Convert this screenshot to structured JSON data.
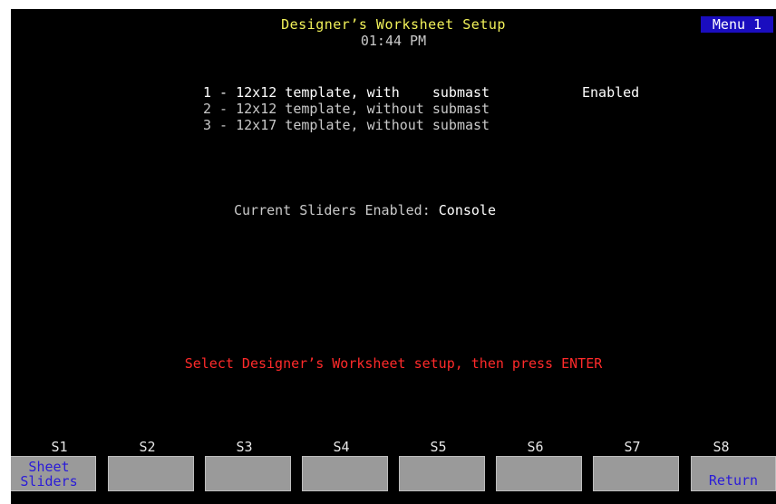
{
  "header": {
    "title": "Designer’s Worksheet Setup",
    "time": "01:44 PM",
    "menu_badge": "Menu 1"
  },
  "options": [
    {
      "text": "1 - 12x12 template, with    submast",
      "status": "Enabled"
    },
    {
      "text": "2 - 12x12 template, without submast",
      "status": ""
    },
    {
      "text": "3 - 12x17 template, without submast",
      "status": ""
    }
  ],
  "sliders": {
    "label": "Current Sliders Enabled:",
    "value": "Console"
  },
  "prompt": "Select Designer’s Worksheet setup, then press ENTER",
  "softkeys": [
    {
      "id": "S1",
      "label": "Sheet\nSliders"
    },
    {
      "id": "S2",
      "label": ""
    },
    {
      "id": "S3",
      "label": ""
    },
    {
      "id": "S4",
      "label": ""
    },
    {
      "id": "S5",
      "label": ""
    },
    {
      "id": "S6",
      "label": ""
    },
    {
      "id": "S7",
      "label": ""
    },
    {
      "id": "S8",
      "label": "Return"
    }
  ],
  "colors": {
    "background": "#000000",
    "title": "#f2f25a",
    "prompt": "#ff2a2a",
    "menu_badge_bg": "#1a0dbf",
    "softkey_bg": "#9a9a9a",
    "softkey_text": "#2a1bd8"
  }
}
